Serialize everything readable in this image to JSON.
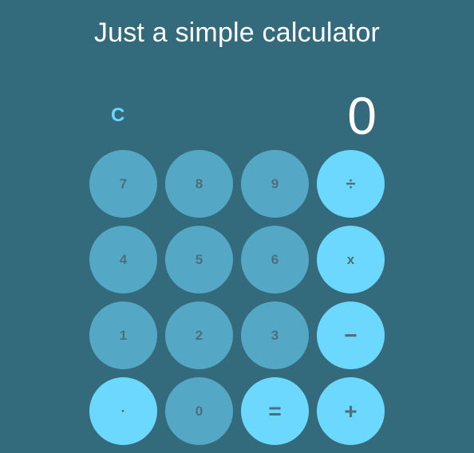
{
  "app": {
    "title": "Just a simple calculator"
  },
  "display": {
    "value": "0"
  },
  "controls": {
    "clear_label": "C"
  },
  "keys": {
    "seven": "7",
    "eight": "8",
    "nine": "9",
    "divide": "÷",
    "four": "4",
    "five": "5",
    "six": "6",
    "multiply": "x",
    "one": "1",
    "two": "2",
    "three": "3",
    "subtract": "−",
    "decimal": "·",
    "zero": "0",
    "equals": "=",
    "add": "+"
  },
  "colors": {
    "background": "#346b7c",
    "number_key": "#54a8c6",
    "operator_key": "#6cd8fe",
    "key_text": "#4c6f7a",
    "clear_text": "#6dd5ff",
    "title_text": "#ffffff"
  }
}
